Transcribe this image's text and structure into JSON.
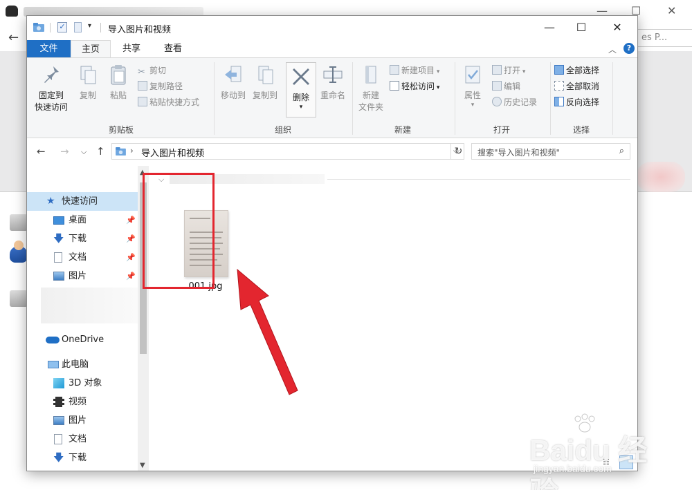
{
  "background": {
    "search_fragment": "es P..."
  },
  "window": {
    "title": "导入图片和视频",
    "controls": {
      "minimize": "—",
      "maximize": "☐",
      "close": "✕"
    }
  },
  "tabs": {
    "file": "文件",
    "home": "主页",
    "share": "共享",
    "view": "查看"
  },
  "ribbon": {
    "clipboard": {
      "label": "剪贴板",
      "pin": "固定到\n快速访问",
      "pin_l1": "固定到",
      "pin_l2": "快速访问",
      "copy": "复制",
      "paste": "粘贴",
      "cut": "剪切",
      "copy_path": "复制路径",
      "paste_shortcut": "粘贴快捷方式"
    },
    "organize": {
      "label": "组织",
      "move_to": "移动到",
      "copy_to": "复制到",
      "delete": "删除",
      "rename": "重命名"
    },
    "new": {
      "label": "新建",
      "new_folder_l1": "新建",
      "new_folder_l2": "文件夹",
      "new_item": "新建项目",
      "easy_access": "轻松访问"
    },
    "open": {
      "label": "打开",
      "properties": "属性",
      "open": "打开",
      "edit": "编辑",
      "history": "历史记录"
    },
    "select": {
      "label": "选择",
      "select_all": "全部选择",
      "select_none": "全部取消",
      "invert": "反向选择"
    }
  },
  "address": {
    "path": "导入图片和视频",
    "search_placeholder": "搜索\"导入图片和视频\""
  },
  "nav": {
    "quick_access": "快速访问",
    "items": [
      {
        "label": "桌面"
      },
      {
        "label": "下载"
      },
      {
        "label": "文档"
      },
      {
        "label": "图片"
      }
    ],
    "onedrive": "OneDrive",
    "this_pc": "此电脑",
    "pc_items": [
      {
        "label": "3D 对象"
      },
      {
        "label": "视频"
      },
      {
        "label": "图片"
      },
      {
        "label": "文档"
      },
      {
        "label": "下载"
      }
    ]
  },
  "files": [
    {
      "name": "001.jpg"
    }
  ],
  "watermark": {
    "brand": "Baidu 经验",
    "url": "jingyan.baidu.com"
  },
  "colors": {
    "accent": "#1f6fc5",
    "selection": "#cce4f7",
    "highlight_red": "#e3262f"
  }
}
